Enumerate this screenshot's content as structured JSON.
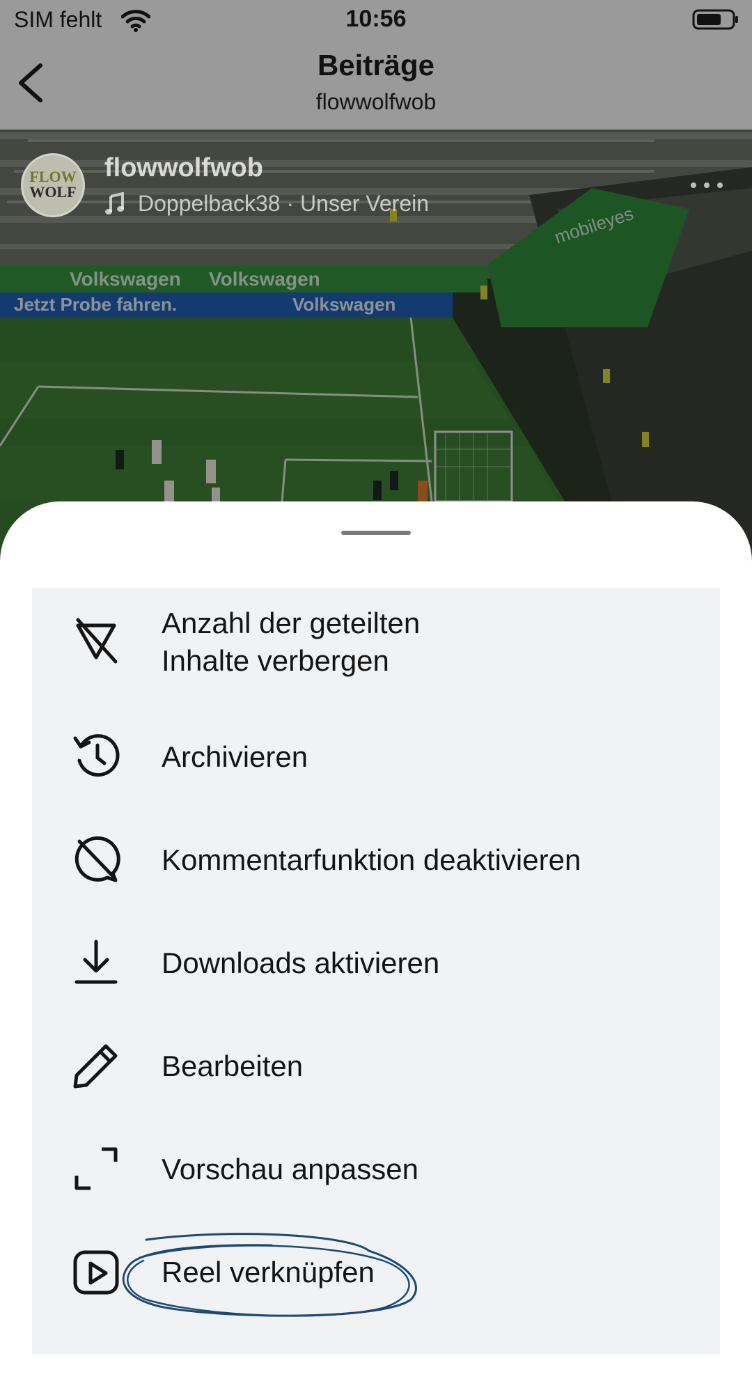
{
  "status_bar": {
    "carrier": "SIM fehlt",
    "time": "10:56",
    "wifi_icon": "wifi-icon",
    "battery_icon": "battery-icon"
  },
  "nav": {
    "title": "Beiträge",
    "subtitle": "flowwolfwob",
    "back_icon": "chevron-left-icon"
  },
  "post": {
    "avatar_line1": "FLOW",
    "avatar_line2": "WOLF",
    "username": "flowwolfwob",
    "audio": "Doppelback38 · Unser Verein",
    "more_icon": "more-horizontal-icon",
    "photo_texts": {
      "board_top": "Volkswagen",
      "board_blue": "Jetzt Probe fahren.",
      "board_blue_brand": "Volkswagen",
      "corner_sponsor": "mobileyes"
    }
  },
  "sheet": {
    "items": [
      {
        "icon": "share-count-off-icon",
        "label_line1": "Anzahl der geteilten",
        "label_line2": "Inhalte verbergen"
      },
      {
        "icon": "archive-clock-icon",
        "label": "Archivieren"
      },
      {
        "icon": "comment-off-icon",
        "label": "Kommentarfunktion deaktivieren"
      },
      {
        "icon": "download-icon",
        "label": "Downloads aktivieren"
      },
      {
        "icon": "pencil-icon",
        "label": "Bearbeiten"
      },
      {
        "icon": "crop-expand-icon",
        "label": "Vorschau anpassen"
      },
      {
        "icon": "reel-icon",
        "label": "Reel verknüpfen"
      }
    ]
  },
  "colors": {
    "header_overlay": "#9a9a9a",
    "sheet_bg": "#ffffff",
    "menu_bg": "#f1f2f4",
    "annotation_ink": "#1b4a73"
  }
}
